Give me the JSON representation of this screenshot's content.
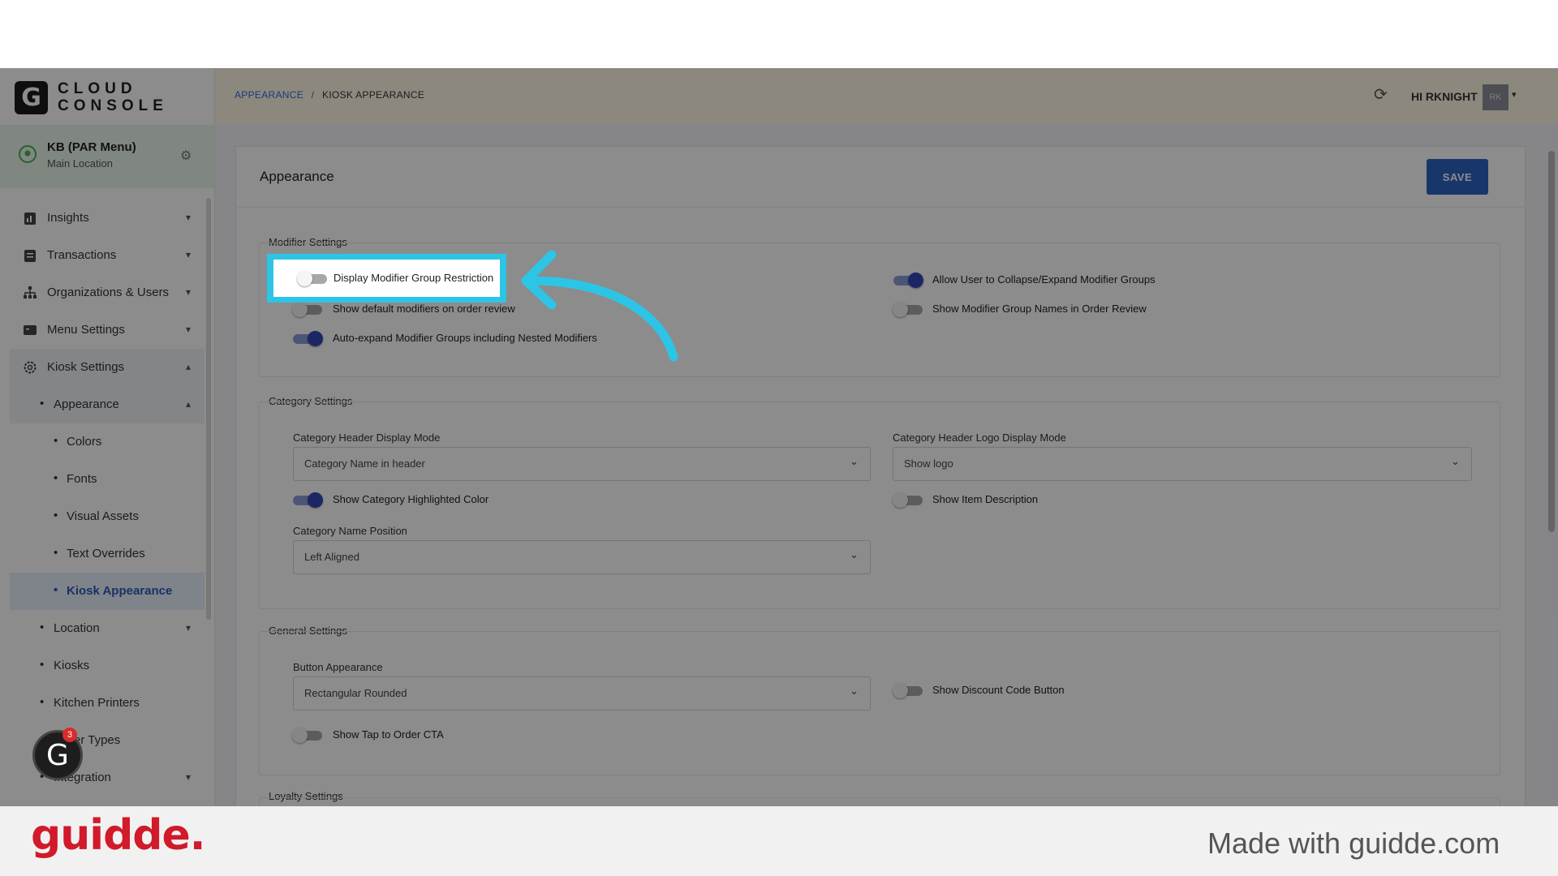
{
  "app": {
    "logo_letter": "G",
    "logo_text_line1": "CLOUD",
    "logo_text_line2": "CONSOLE"
  },
  "location": {
    "name": "KB (PAR Menu)",
    "sub": "Main Location"
  },
  "sidebar": {
    "items": [
      {
        "label": "Insights"
      },
      {
        "label": "Transactions"
      },
      {
        "label": "Organizations & Users"
      },
      {
        "label": "Menu Settings"
      },
      {
        "label": "Kiosk Settings"
      }
    ],
    "kiosk_sub": [
      {
        "label": "Appearance"
      },
      {
        "label": "Location"
      },
      {
        "label": "Kiosks"
      },
      {
        "label": "Kitchen Printers"
      },
      {
        "label": "Order Types"
      },
      {
        "label": "Integration"
      }
    ],
    "appearance_sub": [
      {
        "label": "Colors"
      },
      {
        "label": "Fonts"
      },
      {
        "label": "Visual Assets"
      },
      {
        "label": "Text Overrides"
      },
      {
        "label": "Kiosk Appearance"
      }
    ]
  },
  "breadcrumb": {
    "link": "APPEARANCE",
    "sep": "/",
    "current": "KIOSK APPEARANCE"
  },
  "user": {
    "greeting": "HI RKNIGHT",
    "initials": "RK"
  },
  "page": {
    "title": "Appearance",
    "save_label": "SAVE"
  },
  "modifier": {
    "title": "Modifier Settings",
    "display_restriction": "Display Modifier Group Restriction",
    "show_default": "Show default modifiers on order review",
    "auto_expand": "Auto-expand Modifier Groups including Nested Modifiers",
    "allow_collapse": "Allow User to Collapse/Expand Modifier Groups",
    "show_group_names": "Show Modifier Group Names in Order Review"
  },
  "category": {
    "title": "Category Settings",
    "header_mode_label": "Category Header Display Mode",
    "header_mode_value": "Category Name in header",
    "logo_mode_label": "Category Header Logo Display Mode",
    "logo_mode_value": "Show logo",
    "highlighted": "Show Category Highlighted Color",
    "item_desc": "Show Item Description",
    "name_pos_label": "Category Name Position",
    "name_pos_value": "Left Aligned"
  },
  "general": {
    "title": "General Settings",
    "button_label": "Button Appearance",
    "button_value": "Rectangular Rounded",
    "discount": "Show Discount Code Button",
    "tap_cta": "Show Tap to Order CTA"
  },
  "loyalty": {
    "title": "Loyalty Settings"
  },
  "help": {
    "badge": "3",
    "letter": "G"
  },
  "footer": {
    "brand": "guidde.",
    "made_with": "Made with guidde.com"
  }
}
